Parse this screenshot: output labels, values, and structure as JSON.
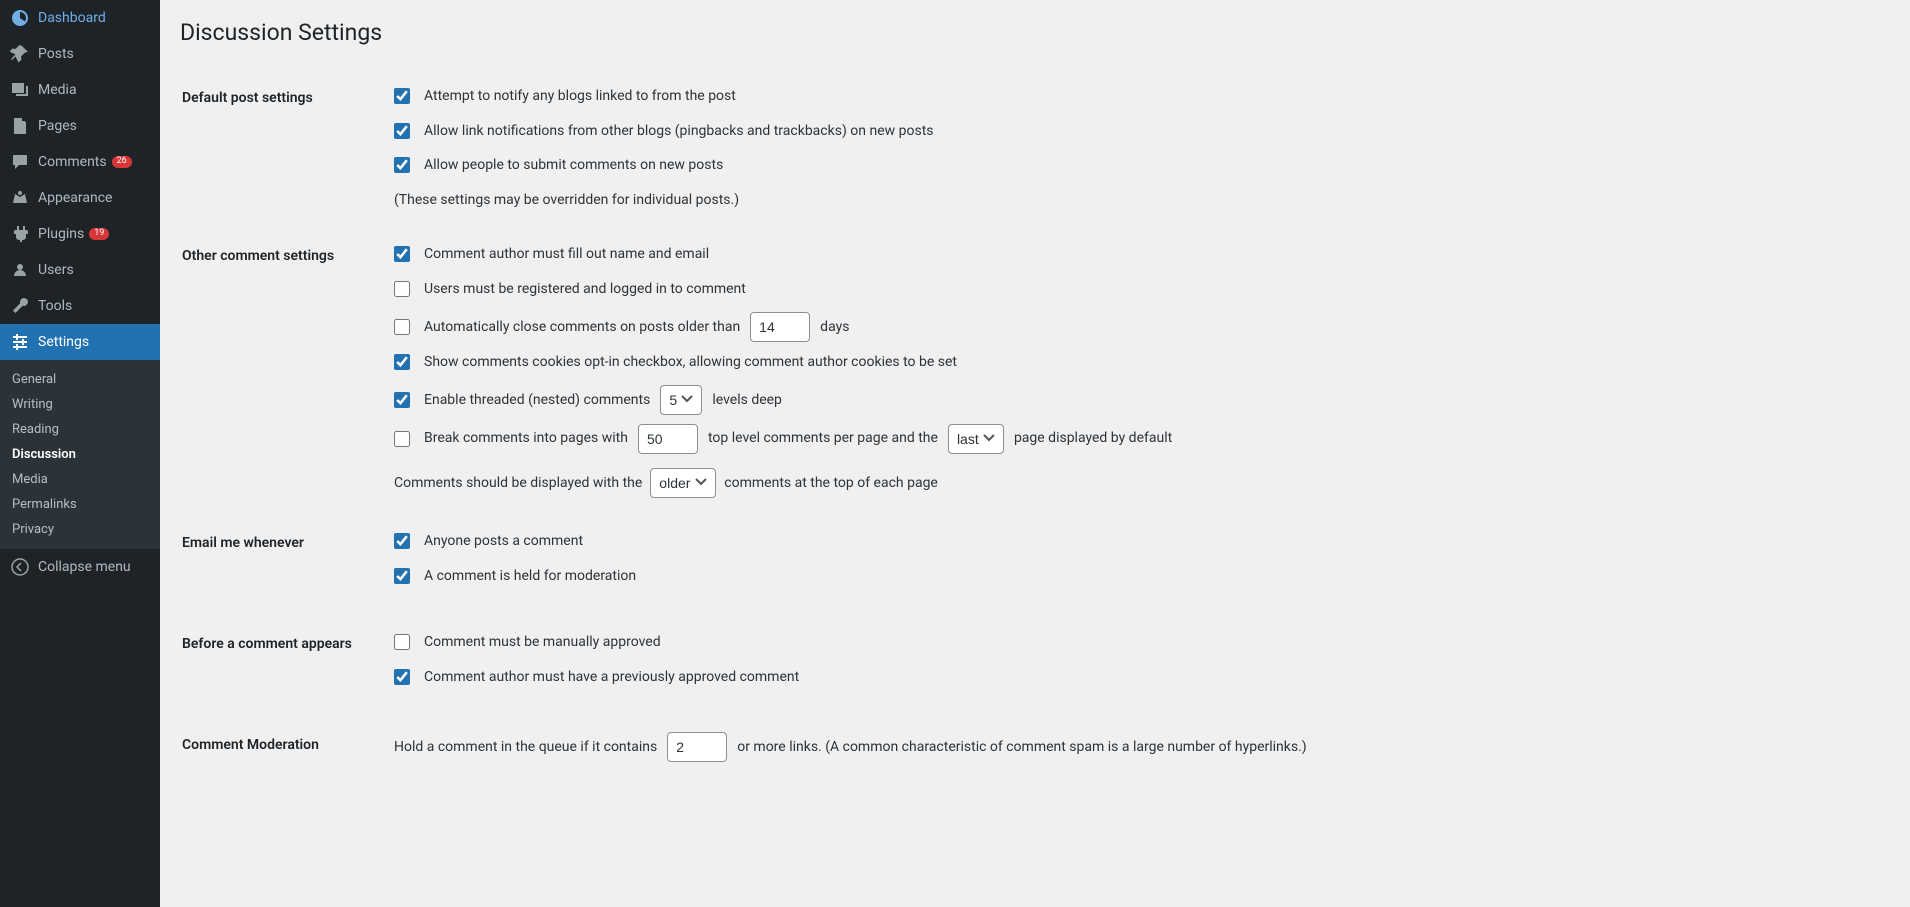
{
  "page_title": "Discussion Settings",
  "sidebar": {
    "items": [
      {
        "label": "Dashboard",
        "icon": "dashboard"
      },
      {
        "label": "Posts",
        "icon": "pin"
      },
      {
        "label": "Media",
        "icon": "media"
      },
      {
        "label": "Pages",
        "icon": "pages"
      },
      {
        "label": "Comments",
        "icon": "comments",
        "badge": "26"
      },
      {
        "label": "Appearance",
        "icon": "appearance"
      },
      {
        "label": "Plugins",
        "icon": "plugins",
        "badge": "19"
      },
      {
        "label": "Users",
        "icon": "users"
      },
      {
        "label": "Tools",
        "icon": "tools"
      },
      {
        "label": "Settings",
        "icon": "settings"
      }
    ],
    "submenu": [
      {
        "label": "General"
      },
      {
        "label": "Writing"
      },
      {
        "label": "Reading"
      },
      {
        "label": "Discussion",
        "current": true
      },
      {
        "label": "Media"
      },
      {
        "label": "Permalinks"
      },
      {
        "label": "Privacy"
      }
    ],
    "collapse": "Collapse menu"
  },
  "sections": {
    "default_post": {
      "heading": "Default post settings",
      "opt_notify": "Attempt to notify any blogs linked to from the post",
      "opt_allow_link": "Allow link notifications from other blogs (pingbacks and trackbacks) on new posts",
      "opt_allow_people": "Allow people to submit comments on new posts",
      "note": "(These settings may be overridden for individual posts.)"
    },
    "other_comment": {
      "heading": "Other comment settings",
      "opt_fill_name": "Comment author must fill out name and email",
      "opt_registered": "Users must be registered and logged in to comment",
      "opt_auto_close_pre": "Automatically close comments on posts older than",
      "opt_auto_close_days_value": "14",
      "opt_auto_close_post": "days",
      "opt_optin": "Show comments cookies opt-in checkbox, allowing comment author cookies to be set",
      "opt_enable_nested_pre": "Enable threaded (nested) comments",
      "opt_enable_nested_select": "5",
      "opt_enable_nested_post": "levels deep",
      "opt_break_pre": "Break comments into pages with",
      "opt_break_value": "50",
      "opt_break_mid": "top level comments per page and the",
      "opt_break_select": "last",
      "opt_break_post": "page displayed by default",
      "opt_order_pre": "Comments should be displayed with the",
      "opt_order_select": "older",
      "opt_order_post": "comments at the top of each page"
    },
    "email_me": {
      "heading": "Email me whenever",
      "opt_anyone": "Anyone posts a comment",
      "opt_held": "A comment is held for moderation"
    },
    "before_appears": {
      "heading": "Before a comment appears",
      "opt_manual": "Comment must be manually approved",
      "opt_prev_approved": "Comment author must have a previously approved comment"
    },
    "moderation": {
      "heading": "Comment Moderation",
      "text_pre": "Hold a comment in the queue if it contains",
      "links_value": "2",
      "text_post": "or more links. (A common characteristic of comment spam is a large number of hyperlinks.)"
    }
  }
}
